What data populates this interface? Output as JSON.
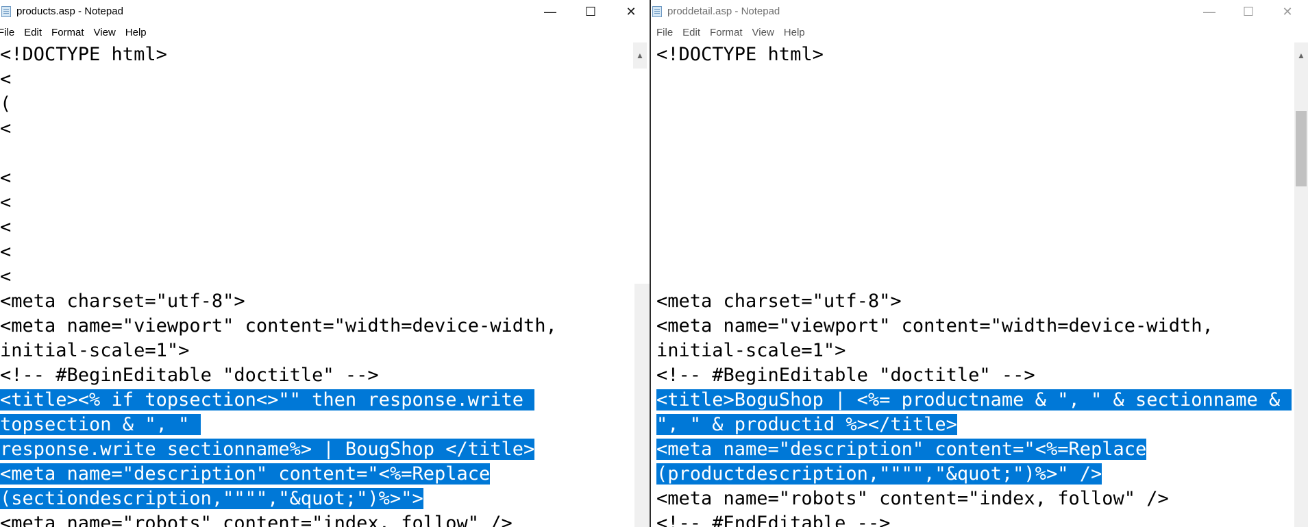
{
  "left": {
    "title": "products.asp - Notepad",
    "caption": {
      "minimize": "—",
      "maximize": "☐",
      "close": "✕"
    },
    "menu": [
      "File",
      "Edit",
      "Format",
      "View",
      "Help"
    ],
    "lines": [
      {
        "text": "<!DOCTYPE html>",
        "selected": false
      },
      {
        "text": "<",
        "selected": false
      },
      {
        "text": "(",
        "selected": false
      },
      {
        "text": "<",
        "selected": false
      },
      {
        "text": "",
        "selected": false
      },
      {
        "text": "<",
        "selected": false
      },
      {
        "text": "<",
        "selected": false
      },
      {
        "text": "<",
        "selected": false
      },
      {
        "text": "<",
        "selected": false
      },
      {
        "text": "<",
        "selected": false
      },
      {
        "text": "<meta charset=\"utf-8\">",
        "selected": false
      },
      {
        "text": "<meta name=\"viewport\" content=\"width=device-width,",
        "selected": false
      },
      {
        "text": "initial-scale=1\">",
        "selected": false
      },
      {
        "text": "<!-- #BeginEditable \"doctitle\" -->",
        "selected": false
      },
      {
        "text": "<title><% if topsection<>\"\" then response.write ",
        "selected": true
      },
      {
        "text": "topsection & \", \" ",
        "selected": true
      },
      {
        "text": "response.write sectionname%> | BougShop </title>",
        "selected": true
      },
      {
        "text": "<meta name=\"description\" content=\"<%=Replace",
        "selected": true
      },
      {
        "text": "(sectiondescription,\"\"\"\",\"&quot;\")%>\">",
        "selected": true
      },
      {
        "text": "<meta name=\"robots\" content=\"index, follow\" />",
        "selected": false
      }
    ]
  },
  "right": {
    "title": "proddetail.asp - Notepad",
    "caption": {
      "minimize": "—",
      "maximize": "☐",
      "close": "✕"
    },
    "menu": [
      "File",
      "Edit",
      "Format",
      "View",
      "Help"
    ],
    "lines": [
      {
        "text": "<!DOCTYPE html>",
        "selected": false
      },
      {
        "text": "",
        "selected": false
      },
      {
        "text": "",
        "selected": false
      },
      {
        "text": "",
        "selected": false
      },
      {
        "text": "",
        "selected": false
      },
      {
        "text": "",
        "selected": false
      },
      {
        "text": "",
        "selected": false
      },
      {
        "text": "",
        "selected": false
      },
      {
        "text": "",
        "selected": false
      },
      {
        "text": "",
        "selected": false
      },
      {
        "text": "<meta charset=\"utf-8\">",
        "selected": false
      },
      {
        "text": "<meta name=\"viewport\" content=\"width=device-width,",
        "selected": false
      },
      {
        "text": "initial-scale=1\">",
        "selected": false
      },
      {
        "text": "<!-- #BeginEditable \"doctitle\" -->",
        "selected": false
      },
      {
        "text": "<title>BoguShop | <%= productname & \", \" & sectionname & ",
        "selected": true
      },
      {
        "text": "\", \" & productid %></title>",
        "selected": true
      },
      {
        "text": "<meta name=\"description\" content=\"<%=Replace",
        "selected": true
      },
      {
        "text": "(productdescription,\"\"\"\",\"&quot;\")%>\" />",
        "selected": true
      },
      {
        "text": "<meta name=\"robots\" content=\"index, follow\" />",
        "selected": false
      },
      {
        "text": "<!-- #EndEditable -->",
        "selected": false
      }
    ]
  }
}
